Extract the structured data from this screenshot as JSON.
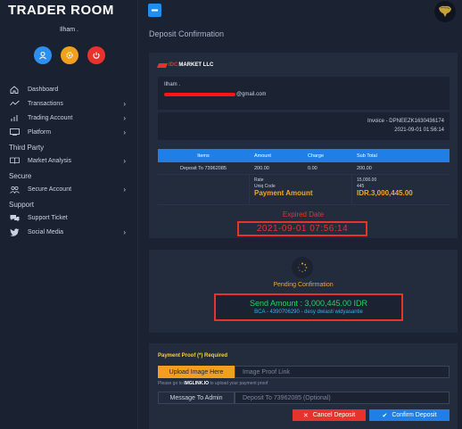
{
  "sidebar": {
    "brand": "TRADER ROOM",
    "user_name": "Ilham .",
    "items": [
      {
        "label": "Dashboard",
        "icon": "home-icon",
        "chevron": ""
      },
      {
        "label": "Transactions",
        "icon": "transactions-icon",
        "chevron": "›"
      },
      {
        "label": "Trading Account",
        "icon": "bar-chart-icon",
        "chevron": "›"
      },
      {
        "label": "Platform",
        "icon": "monitor-icon",
        "chevron": "›"
      }
    ],
    "section_third_party": "Third Party",
    "market_analysis": {
      "label": "Market Analysis",
      "icon": "book-icon",
      "chevron": "›"
    },
    "section_secure": "Secure",
    "secure_account": {
      "label": "Secure Account",
      "icon": "users-icon",
      "chevron": "›"
    },
    "section_support": "Support",
    "support_ticket": {
      "label": "Support Ticket",
      "icon": "chat-icon"
    },
    "social_media": {
      "label": "Social Media",
      "icon": "twitter-icon",
      "chevron": "›"
    }
  },
  "header": {
    "page_title": "Deposit Confirmation"
  },
  "invoice": {
    "brand_red": "IDC",
    "brand_white": "MARKET LLC",
    "bill_to_name": "Ilham .",
    "bill_to_email": "@gmail.com",
    "invoice_no": "Invoice - DPNEEZK1630436174",
    "invoice_date": "2021-09-01 01:56:14"
  },
  "table": {
    "headers": [
      "Items",
      "Amount",
      "Charge",
      "Sub Total"
    ],
    "row": [
      "Deposit To 73962085",
      "200.00",
      "0.00",
      "200.00"
    ],
    "rate_label": "Rate",
    "uniq_label": "Uniq Code",
    "payment_label": "Payment Amount",
    "rate_value": "15,000.00",
    "uniq_value": "445",
    "payment_value": "IDR.3,000,445.00"
  },
  "expiry": {
    "label": "Expired Date",
    "value": "2021-09-01 07:56:14"
  },
  "status": {
    "pending": "Pending Confirmation",
    "send_amount": "Send Amount : 3,000,445.00 IDR",
    "bank_info": "BCA - 4390706290 - desy dwiasti widyasantie"
  },
  "proof": {
    "title": "Payment Proof (*) Required",
    "upload_label": "Upload Image Here",
    "image_placeholder": "Image Proof Link",
    "hint_pre": "Please go to",
    "hint_link": "IMGLINK.IO",
    "hint_post": "to upload your payment proof",
    "message_label": "Message To Admin",
    "message_placeholder": "Deposit To 73962085 (Optional)",
    "cancel_label": "Cancel Deposit",
    "confirm_label": "Confirm Deposit"
  },
  "colors": {
    "background": "#1b2333",
    "card": "#222c3d",
    "accent_blue": "#1f7fe6",
    "accent_orange": "#f5a623",
    "danger": "#e8322c",
    "success": "#23d160"
  }
}
